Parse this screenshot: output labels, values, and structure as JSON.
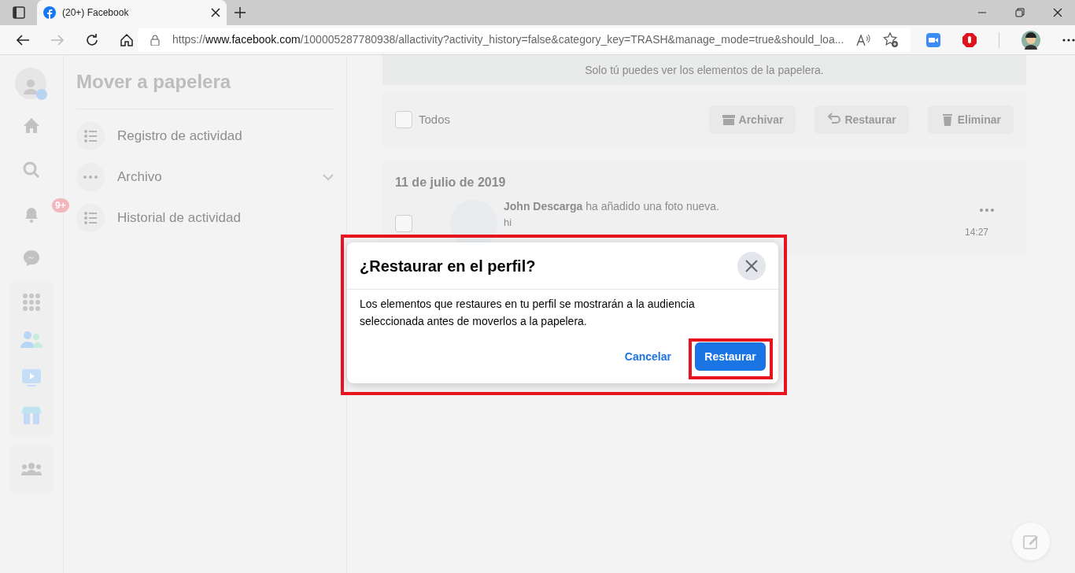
{
  "browser": {
    "tab_title": "(20+) Facebook",
    "url_scheme": "https://",
    "url_host": "www.facebook.com",
    "url_path": "/100005287780938/allactivity?activity_history=false&category_key=TRASH&manage_mode=true&should_loa..."
  },
  "rail": {
    "notification_badge": "9+"
  },
  "sidebar": {
    "title": "Mover a papelera",
    "items": [
      {
        "label": "Registro de actividad",
        "kind": "list",
        "expandable": false
      },
      {
        "label": "Archivo",
        "kind": "dots",
        "expandable": true
      },
      {
        "label": "Historial de actividad",
        "kind": "list",
        "expandable": false
      }
    ]
  },
  "notice": "Solo tú puedes ver los elementos de la papelera.",
  "toolbar": {
    "select_all": {
      "label": "Todos",
      "checked": false
    },
    "buttons": [
      {
        "label": "Archivar",
        "kind": "archive",
        "disabled": true
      },
      {
        "label": "Restaurar",
        "kind": "undo",
        "disabled": true
      },
      {
        "label": "Eliminar",
        "kind": "trash",
        "disabled": true
      }
    ]
  },
  "feed": {
    "date": "11 de julio de 2019",
    "items": [
      {
        "text": "**John Descarga** ha añadido una foto nueva.",
        "caption": "hi",
        "time": "14:27",
        "checked": false
      }
    ]
  },
  "dialog": {
    "title": "¿Restaurar en el perfil?",
    "body": "Los elementos que restaures en tu perfil se mostrarán a la audiencia seleccionada antes de moverlos a la papelera.",
    "cancel": "Cancelar",
    "confirm": "Restaurar",
    "highlighted": true,
    "confirm_highlighted": true
  }
}
